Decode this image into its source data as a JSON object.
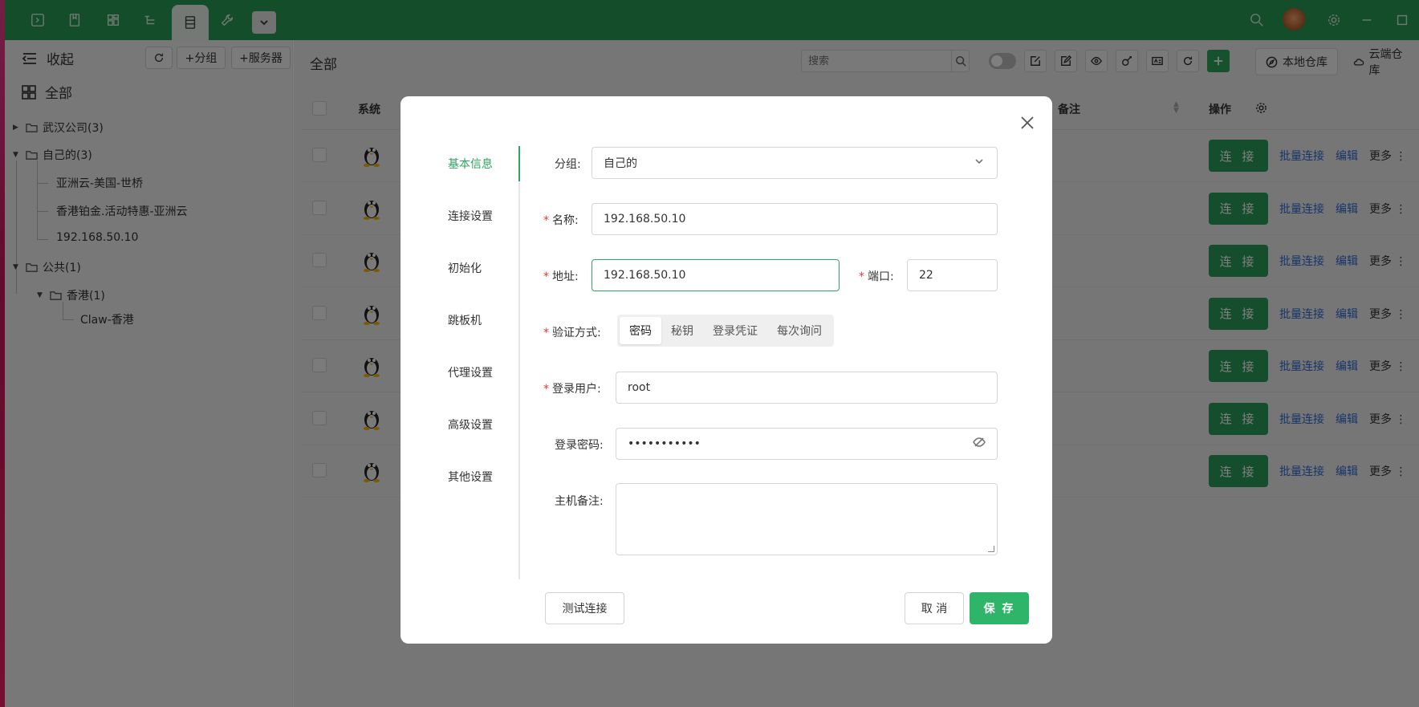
{
  "sidebar": {
    "collapse_label": "收起",
    "refresh_label": "",
    "add_group_label": "+分组",
    "add_server_label": "+服务器",
    "all_label": "全部",
    "tree": [
      {
        "label": "武汉公司(3)"
      },
      {
        "label": "自己的(3)"
      },
      {
        "label": "亚洲云-美国-世桥"
      },
      {
        "label": "香港铂金.活动特惠-亚洲云"
      },
      {
        "label": "192.168.50.10"
      },
      {
        "label": "公共(1)"
      },
      {
        "label": "香港(1)"
      },
      {
        "label": "Claw-香港"
      }
    ]
  },
  "main": {
    "title": "全部",
    "search_placeholder": "搜索",
    "local_repo_label": "本地仓库",
    "cloud_repo_label": "云端仓库",
    "columns": {
      "system": "系统",
      "remark": "备注",
      "actions": "操作"
    },
    "row_actions": {
      "connect": "连 接",
      "batch_connect": "批量连接",
      "edit": "编辑",
      "more": "更多"
    },
    "row_count": 7
  },
  "dialog": {
    "nav": [
      {
        "label": "基本信息"
      },
      {
        "label": "连接设置"
      },
      {
        "label": "初始化"
      },
      {
        "label": "跳板机"
      },
      {
        "label": "代理设置"
      },
      {
        "label": "高级设置"
      },
      {
        "label": "其他设置"
      }
    ],
    "group": {
      "label": "分组:",
      "value": "自己的"
    },
    "name": {
      "label": "名称:",
      "value": "192.168.50.10"
    },
    "address": {
      "label": "地址:",
      "value": "192.168.50.10"
    },
    "port": {
      "label": "端口:",
      "value": "22"
    },
    "auth": {
      "label": "验证方式:",
      "options": [
        "密码",
        "秘钥",
        "登录凭证",
        "每次询问"
      ],
      "selected": "密码"
    },
    "user": {
      "label": "登录用户:",
      "value": "root"
    },
    "password": {
      "label": "登录密码:",
      "value": "•••••••••••"
    },
    "note": {
      "label": "主机备注:",
      "value": ""
    },
    "test_button": "测试连接",
    "cancel_button": "取 消",
    "save_button": "保 存",
    "required_mark": "*"
  },
  "colors": {
    "brand_green": "#279a52",
    "primary_button": "#2fb56a",
    "link_blue": "#2e6bd4"
  }
}
